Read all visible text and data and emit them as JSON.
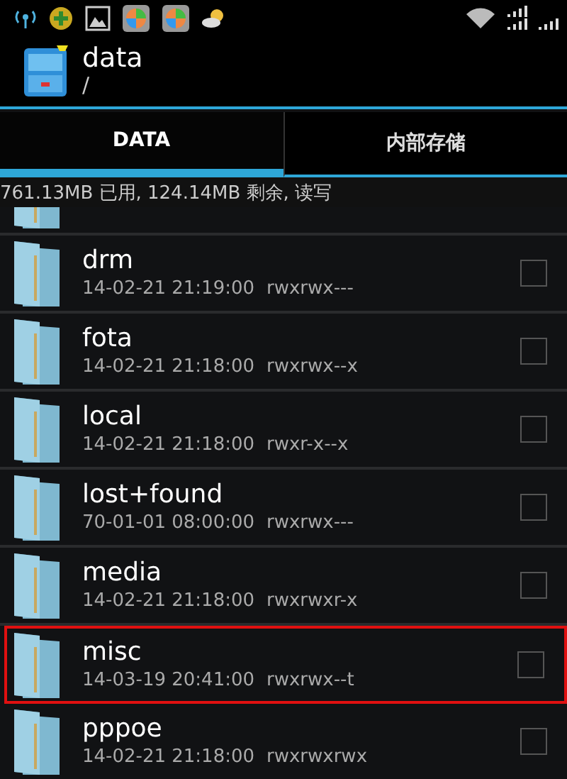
{
  "action_bar": {
    "title": "data",
    "subtitle": "/"
  },
  "tabs": [
    {
      "label": "DATA",
      "selected": true
    },
    {
      "label": "内部存储",
      "selected": false
    }
  ],
  "storage_info": "761.13MB 已用, 124.14MB 剩余, 读写",
  "files": [
    {
      "name": "drm",
      "date": "14-02-21 21:19:00",
      "permissions": "rwxrwx---",
      "checked": false,
      "highlighted": false
    },
    {
      "name": "fota",
      "date": "14-02-21 21:18:00",
      "permissions": "rwxrwx--x",
      "checked": false,
      "highlighted": false
    },
    {
      "name": "local",
      "date": "14-02-21 21:18:00",
      "permissions": "rwxr-x--x",
      "checked": false,
      "highlighted": false
    },
    {
      "name": "lost+found",
      "date": "70-01-01 08:00:00",
      "permissions": "rwxrwx---",
      "checked": false,
      "highlighted": false
    },
    {
      "name": "media",
      "date": "14-02-21 21:18:00",
      "permissions": "rwxrwxr-x",
      "checked": false,
      "highlighted": false
    },
    {
      "name": "misc",
      "date": "14-03-19 20:41:00",
      "permissions": "rwxrwx--t",
      "checked": false,
      "highlighted": true
    },
    {
      "name": "pppoe",
      "date": "14-02-21 21:18:00",
      "permissions": "rwxrwxrwx",
      "checked": false,
      "highlighted": false
    }
  ]
}
